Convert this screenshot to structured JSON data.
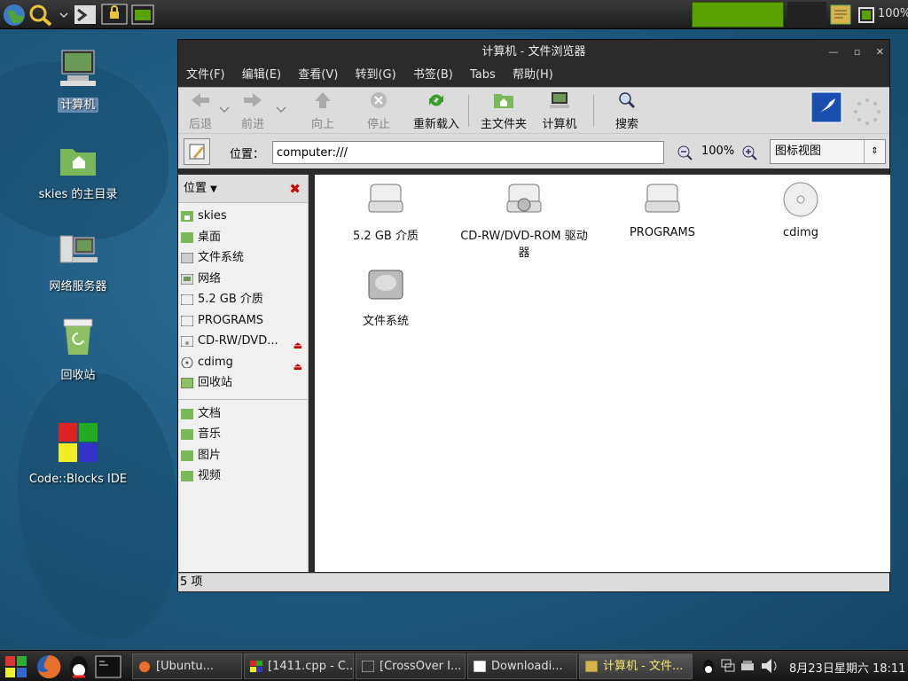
{
  "top_panel": {
    "battery": "100%"
  },
  "desktop": {
    "icons": [
      {
        "label": "计算机"
      },
      {
        "label": "skies 的主目录"
      },
      {
        "label": "网络服务器"
      },
      {
        "label": "回收站"
      },
      {
        "label": "Code::Blocks IDE"
      }
    ]
  },
  "window": {
    "title": "计算机 - 文件浏览器",
    "menu": [
      "文件(F)",
      "编辑(E)",
      "查看(V)",
      "转到(G)",
      "书签(B)",
      "Tabs",
      "帮助(H)"
    ],
    "toolbar": {
      "back": "后退",
      "forward": "前进",
      "up": "向上",
      "stop": "停止",
      "reload": "重新载入",
      "home": "主文件夹",
      "computer": "计算机",
      "search": "搜索"
    },
    "location": {
      "label": "位置：",
      "value": "computer:///",
      "zoom": "100%",
      "view_mode": "图标视图"
    },
    "sidebar": {
      "header": "位置",
      "places": [
        "skies",
        "桌面",
        "文件系统",
        "网络",
        "5.2 GB 介质",
        "PROGRAMS",
        "CD-RW/DVD...",
        "cdimg",
        "回收站"
      ],
      "bookmarks": [
        "文档",
        "音乐",
        "图片",
        "视频"
      ]
    },
    "files": [
      "5.2 GB 介质",
      "CD-RW/DVD-ROM 驱动器",
      "PROGRAMS",
      "cdimg",
      "文件系统"
    ],
    "status": "5 项"
  },
  "taskbar": {
    "tasks": [
      "[Ubuntu...",
      "[1411.cpp - C...",
      "[CrossOver I...",
      "Downloadi...",
      "计算机 - 文件..."
    ],
    "clock": "8月23日星期六 18:11"
  },
  "colors": {
    "accent_green": "#5aa200",
    "active_task_text": "#f5e76a"
  }
}
